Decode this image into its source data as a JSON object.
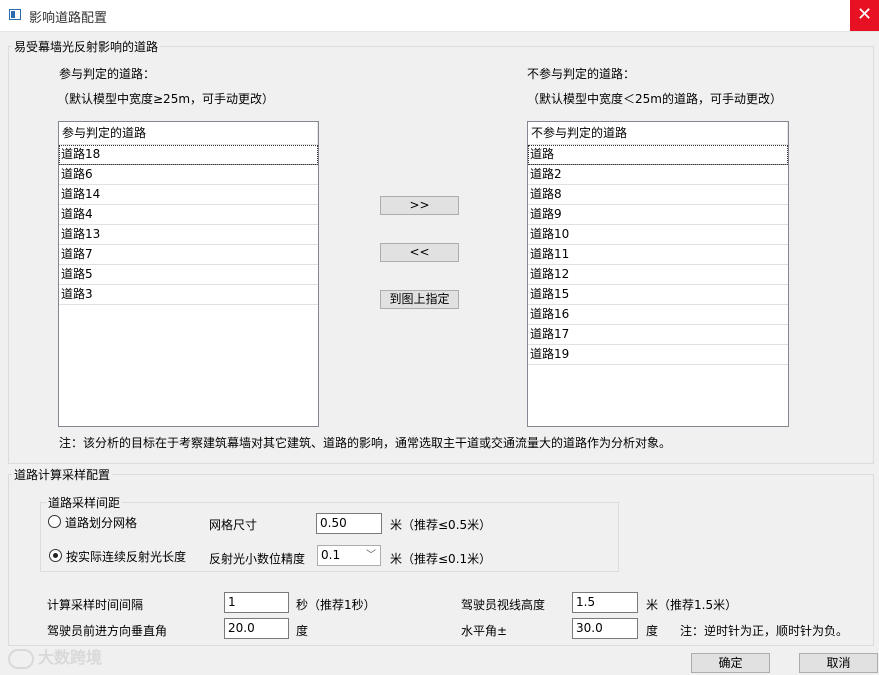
{
  "window": {
    "title": "影响道路配置",
    "close_glyph": "✕"
  },
  "section1": {
    "legend": "易受幕墙光反射影响的道路",
    "left_label": "参与判定的道路：",
    "left_hint": "（默认模型中宽度≥25m，可手动更改）",
    "right_label": "不参与判定的道路：",
    "right_hint": "（默认模型中宽度＜25m的道路，可手动更改）",
    "left_list": {
      "header": "参与判定的道路",
      "items": [
        "道路18",
        "道路6",
        "道路14",
        "道路4",
        "道路13",
        "道路7",
        "道路5",
        "道路3"
      ]
    },
    "right_list": {
      "header": "不参与判定的道路",
      "items": [
        "道路",
        "道路2",
        "道路8",
        "道路9",
        "道路10",
        "道路11",
        "道路12",
        "道路15",
        "道路16",
        "道路17",
        "道路19"
      ]
    },
    "move_right": ">>",
    "move_left": "<<",
    "pick_on_map": "到图上指定",
    "note": "注：该分析的目标在于考察建筑幕墙对其它建筑、道路的影响，通常选取主干道或交通流量大的道路作为分析对象。"
  },
  "section2": {
    "legend": "道路计算采样配置",
    "sampling": {
      "legend": "道路采样间距",
      "option_grid": "道路划分网格",
      "option_continuous": "按实际连续反射光长度",
      "selected": "option_continuous",
      "grid_size_label": "网格尺寸",
      "grid_size_value": "0.50",
      "grid_size_hint": "米（推荐≤0.5米）",
      "precision_label": "反射光小数位精度",
      "precision_value": "0.1",
      "precision_hint": "米（推荐≤0.1米）"
    },
    "interval_label": "计算采样时间间隔",
    "interval_value": "1",
    "interval_hint": "秒（推荐1秒）",
    "eye_height_label": "驾驶员视线高度",
    "eye_height_value": "1.5",
    "eye_height_hint": "米（推荐1.5米）",
    "vertical_angle_label": "驾驶员前进方向垂直角",
    "vertical_angle_value": "20.0",
    "vertical_angle_unit": "度",
    "horizontal_angle_label": "水平角±",
    "horizontal_angle_value": "30.0",
    "horizontal_angle_unit": "度",
    "angle_note": "注：逆时针为正，顺时针为负。"
  },
  "footer": {
    "ok": "确定",
    "cancel": "取消"
  },
  "watermark": {
    "text": "大数跨境"
  }
}
